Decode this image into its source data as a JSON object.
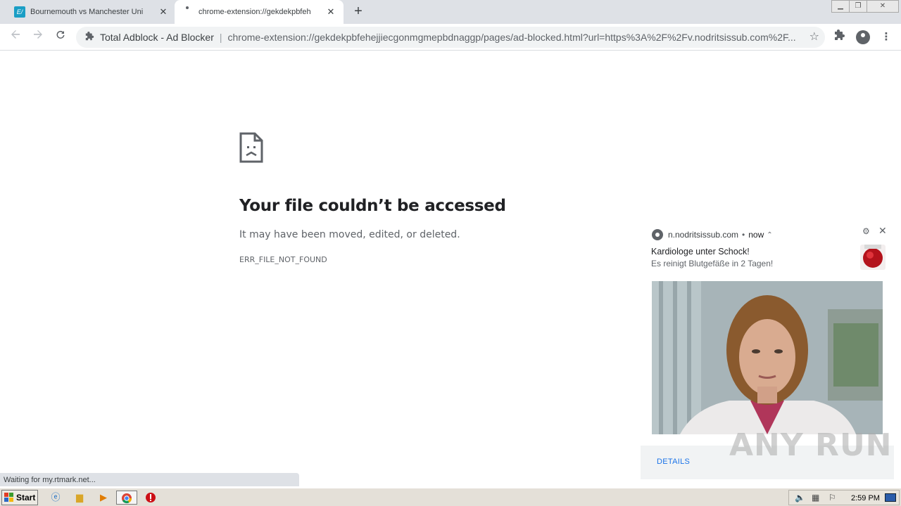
{
  "tabs": [
    {
      "title": "Bournemouth vs Manchester United",
      "favicon": "E/"
    },
    {
      "title": "chrome-extension://gekdekpbfehejj"
    }
  ],
  "toolbar": {
    "extension_name": "Total Adblock - Ad Blocker",
    "separator": "|",
    "url": "chrome-extension://gekdekpbfehejjiecgonmgmepbdnaggp/pages/ad-blocked.html?url=https%3A%2F%2Fv.nodritsissub.com%2F..."
  },
  "error": {
    "title": "Your file couldn’t be accessed",
    "description": "It may have been moved, edited, or deleted.",
    "code": "ERR_FILE_NOT_FOUND"
  },
  "notification": {
    "source": "n.nodritsissub.com",
    "dot": "•",
    "time": "now",
    "title": "Kardiologe unter Schock!",
    "body": "Es reinigt Blutgefäße in 2 Tagen!",
    "action": "DETAILS"
  },
  "status_bubble": "Waiting for my.rtmark.net...",
  "taskbar": {
    "start_label": "Start",
    "clock": "2:59 PM"
  },
  "watermark": "ANY RUN",
  "colors": {
    "tabstrip": "#dee1e6",
    "omnibox": "#f1f3f4",
    "link": "#1a73e8"
  }
}
